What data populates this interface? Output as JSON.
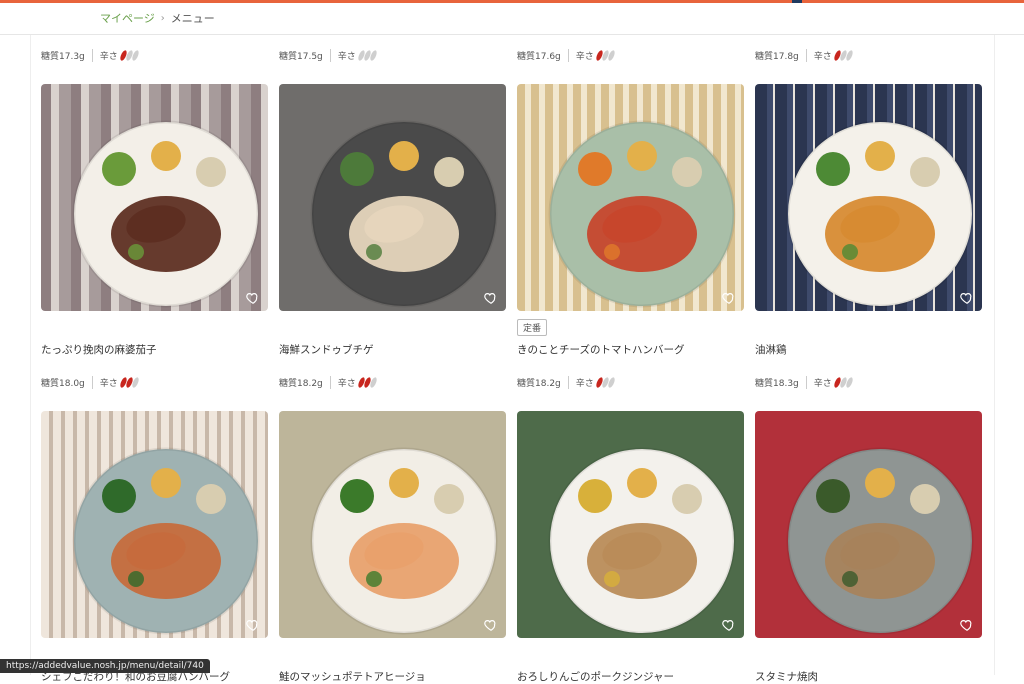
{
  "breadcrumb": {
    "home": "マイページ",
    "sep": "›",
    "current": "メニュー"
  },
  "spice_label": "辛さ",
  "menu": [
    {
      "sugar": "糖質17.3g",
      "spice": 1,
      "name": "たっぷり挽肉の麻婆茄子",
      "tag": ""
    },
    {
      "sugar": "糖質17.5g",
      "spice": 0,
      "name": "海鮮スンドゥブチゲ",
      "tag": ""
    },
    {
      "sugar": "糖質17.6g",
      "spice": 1,
      "name": "きのことチーズのトマトハンバーグ",
      "tag": "定番"
    },
    {
      "sugar": "糖質17.8g",
      "spice": 1,
      "name": "油淋鶏",
      "tag": ""
    },
    {
      "sugar": "糖質18.0g",
      "spice": 2,
      "name": "シェフこだわり！和のお豆腐ハンバーグ",
      "tag": ""
    },
    {
      "sugar": "糖質18.2g",
      "spice": 2,
      "name": "鮭のマッシュポテトアヒージョ",
      "tag": ""
    },
    {
      "sugar": "糖質18.2g",
      "spice": 1,
      "name": "おろしりんごのポークジンジャー",
      "tag": ""
    },
    {
      "sugar": "糖質18.3g",
      "spice": 1,
      "name": "スタミナ焼肉",
      "tag": ""
    }
  ],
  "status_url": "https://addedvalue.nosh.jp/menu/detail/740",
  "colors": {
    "accent_bar": "#e8643c",
    "link": "#6aa04b",
    "pepper": "#c8261e"
  }
}
